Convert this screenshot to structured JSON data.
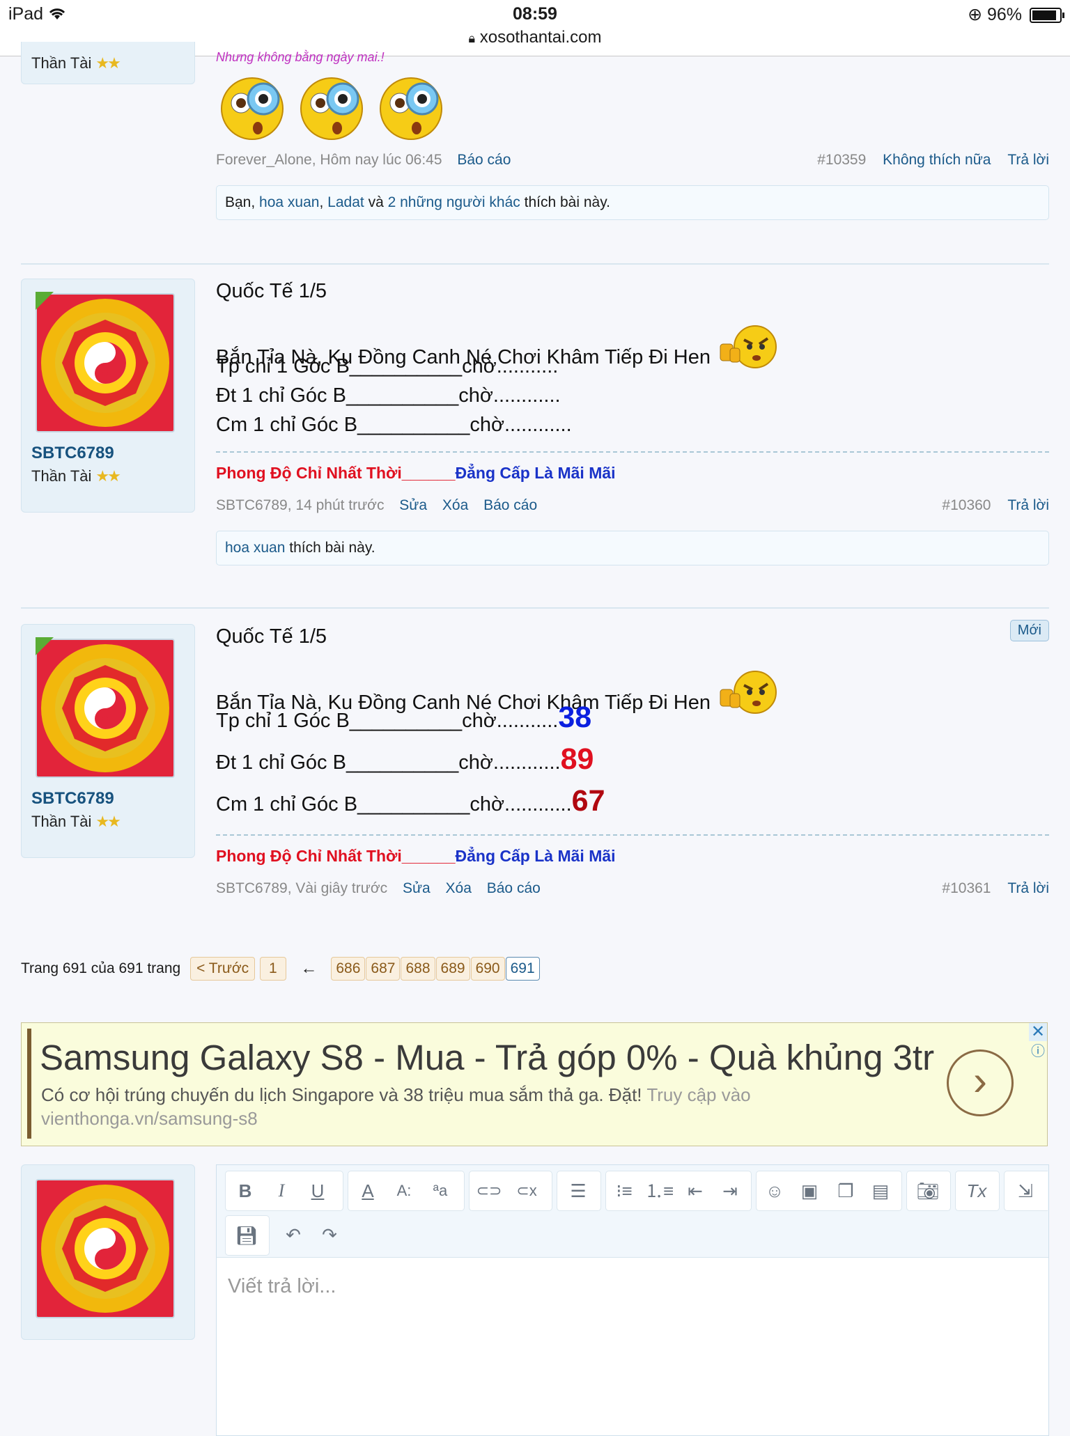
{
  "status_bar": {
    "device": "iPad",
    "time": "08:59",
    "battery": "96%",
    "url": "xosothantai.com"
  },
  "post1": {
    "user_title": "Thần Tài",
    "quote_text": "Nhưng không bằng ngày mai.!",
    "meta_author": "Forever_Alone, Hôm nay lúc 06:45",
    "report": "Báo cáo",
    "post_num": "#10359",
    "unlike": "Không thích nữa",
    "reply": "Trả lời",
    "likes_you": "Bạn,",
    "likes_user1": "hoa xuan",
    "likes_comma": ",",
    "likes_user2": "Ladat",
    "likes_and": "và",
    "likes_others": "2 những người khác",
    "likes_suffix": "thích bài này."
  },
  "post2": {
    "username": "SBTC6789",
    "user_title": "Thần Tài",
    "title": "Quốc Tế 1/5",
    "line1": "Bắn Tỉa Nà, Ku Đồng Canh Né Chơi Khâm Tiếp Đi Hen",
    "line2": "Tp chỉ 1 Góc B__________chờ...........",
    "line3": "Đt 1 chỉ Góc B__________chờ............",
    "line4": "Cm 1 chỉ Góc B__________chờ............",
    "sig_red": "Phong Độ Chỉ Nhất Thời______",
    "sig_blue": "Đẳng Cấp Là Mãi Mãi",
    "meta_author": "SBTC6789, 14 phút trước",
    "edit": "Sửa",
    "delete": "Xóa",
    "report": "Báo cáo",
    "post_num": "#10360",
    "reply": "Trả lời",
    "likes_user": "hoa xuan",
    "likes_suffix": "thích bài này."
  },
  "post3": {
    "username": "SBTC6789",
    "user_title": "Thần Tài",
    "new_badge": "Mới",
    "title": "Quốc Tế 1/5",
    "line1": "Bắn Tỉa Nà, Ku Đồng Canh Né Chơi Khâm Tiếp Đi Hen",
    "line2": "Tp chỉ 1 Góc B__________chờ...........",
    "num2": "38",
    "line3": "Đt 1 chỉ Góc B__________chờ............",
    "num3": "89",
    "line4": "Cm 1 chỉ Góc B__________chờ............",
    "num4": "67",
    "sig_red": "Phong Độ Chỉ Nhất Thời______",
    "sig_blue": "Đẳng Cấp Là Mãi Mãi",
    "meta_author": "SBTC6789, Vài giây trước",
    "edit": "Sửa",
    "delete": "Xóa",
    "report": "Báo cáo",
    "post_num": "#10361",
    "reply": "Trả lời"
  },
  "pagination": {
    "label": "Trang 691 của 691 trang",
    "prev": "< Trước",
    "first": "1",
    "arrow": "←",
    "pages": [
      "686",
      "687",
      "688",
      "689",
      "690",
      "691"
    ]
  },
  "ad": {
    "title": "Samsung Galaxy S8 - Mua - Trả góp 0% - Quà khủng 3tr",
    "desc": "Có cơ hội trúng chuyến du lịch Singapore và 38 triệu mua sắm thả ga. Đặt!",
    "cta": "Truy cập vào",
    "url": "vienthonga.vn/samsung-s8"
  },
  "editor": {
    "placeholder": "Viết trả lời..."
  },
  "colors": {
    "accent": "#1b5a8a",
    "sig_red": "#e01020",
    "sig_blue": "#1a33c8",
    "num_blue": "#0a1fe0",
    "num_red": "#e01020",
    "num_dark_red": "#b00810"
  }
}
